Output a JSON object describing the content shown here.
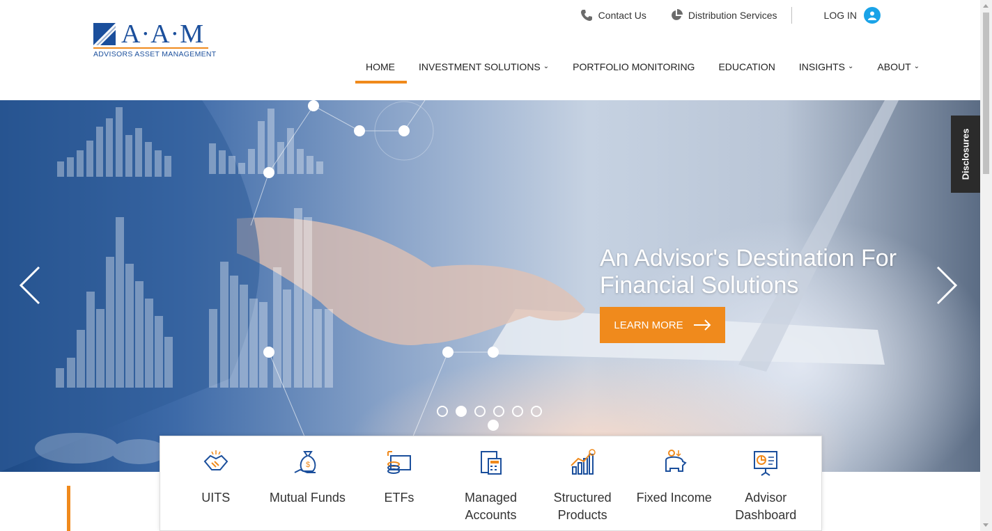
{
  "header": {
    "utility": {
      "contact": "Contact Us",
      "distribution": "Distribution Services",
      "login": "LOG IN"
    },
    "logo": {
      "wordmark": "A·A·M",
      "tagline": "ADVISORS ASSET MANAGEMENT"
    },
    "nav": [
      {
        "label": "HOME",
        "active": true
      },
      {
        "label": "INVESTMENT SOLUTIONS",
        "dropdown": true
      },
      {
        "label": "PORTFOLIO MONITORING"
      },
      {
        "label": "EDUCATION"
      },
      {
        "label": "INSIGHTS",
        "dropdown": true
      },
      {
        "label": "ABOUT",
        "dropdown": true
      }
    ]
  },
  "hero": {
    "title": "An Advisor's Destination For Financial Solutions",
    "cta": "LEARN MORE",
    "slide_count": 6,
    "active_slide": 2,
    "disclosures": "Disclosures"
  },
  "products": [
    {
      "label": "UITS",
      "icon": "handshake-icon"
    },
    {
      "label": "Mutual Funds",
      "icon": "money-bag-icon"
    },
    {
      "label": "ETFs",
      "icon": "cash-stack-icon"
    },
    {
      "label": "Managed Accounts",
      "icon": "calculator-icon"
    },
    {
      "label": "Structured Products",
      "icon": "growth-chart-icon"
    },
    {
      "label": "Fixed Income",
      "icon": "piggy-bank-icon"
    },
    {
      "label": "Advisor Dashboard",
      "icon": "presentation-board-icon"
    }
  ],
  "colors": {
    "accent_orange": "#f08a1c",
    "brand_blue": "#1b4f9c",
    "login_blue": "#1aa3e8"
  }
}
